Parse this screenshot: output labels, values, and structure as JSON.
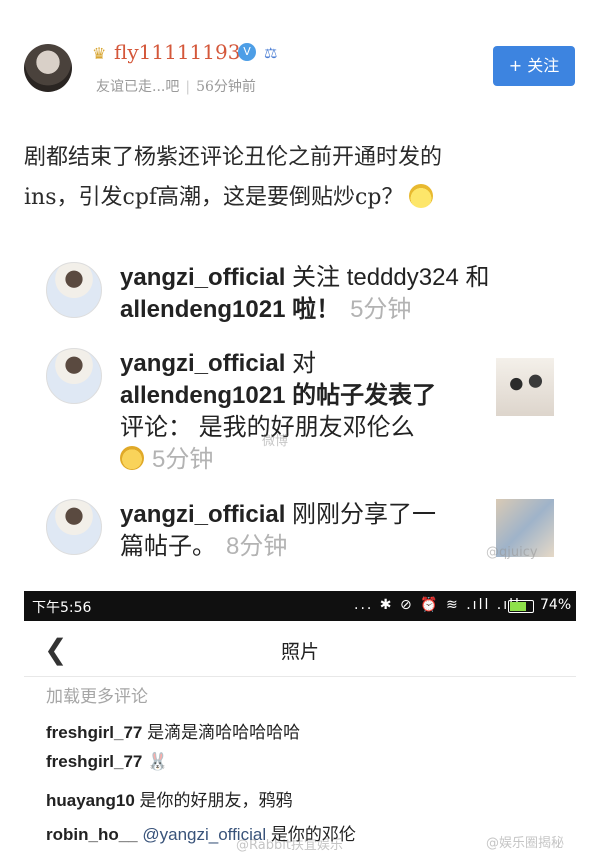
{
  "post": {
    "username": "fly11111193",
    "subtitle": "友谊已走...吧",
    "time_ago": "56分钟前",
    "follow_label": "+ 关注",
    "text_line1": "剧都结束了杨紫还评论丑伦之前开通时发的",
    "text_line2": "ins，引发cpf高潮，这是要倒贴炒cp？"
  },
  "activities": [
    {
      "user": "yangzi_official",
      "line1": "关注 tedddy324 和",
      "line2": "allendeng1021 啦！",
      "time": "5分钟"
    },
    {
      "user": "yangzi_official",
      "line1": "对",
      "line2": "allendeng1021 的帖子发表了",
      "line3": "评论： 是我的好朋友邓伦么",
      "time": "5分钟"
    },
    {
      "user": "yangzi_official",
      "line1": "刚刚分享了一",
      "line2": "篇帖子。",
      "time": "8分钟"
    }
  ],
  "status_bar": {
    "time": "下午5:56",
    "icons": "... ✱ ⊘ ⏰ ≋ .ıll .ıll",
    "battery_pct": "74%",
    "battery_level": 0.74
  },
  "nav": {
    "title": "照片"
  },
  "load_more": "加载更多评论",
  "comments": [
    {
      "user": "freshgirl_77",
      "text": "是滴是滴哈哈哈哈哈"
    },
    {
      "user": "freshgirl_77",
      "text": "🐰"
    },
    {
      "user": "huayang10",
      "text": "是你的好朋友，鸦鸦"
    },
    {
      "user": "robin_ho__",
      "mention": "@yangzi_official",
      "text": "是你的邓伦"
    }
  ],
  "watermarks": {
    "w1": "微博",
    "w2": "@qjuicy",
    "w3": "@Rabbit扶宜娱乐",
    "w4": "@娱乐圈揭秘"
  }
}
